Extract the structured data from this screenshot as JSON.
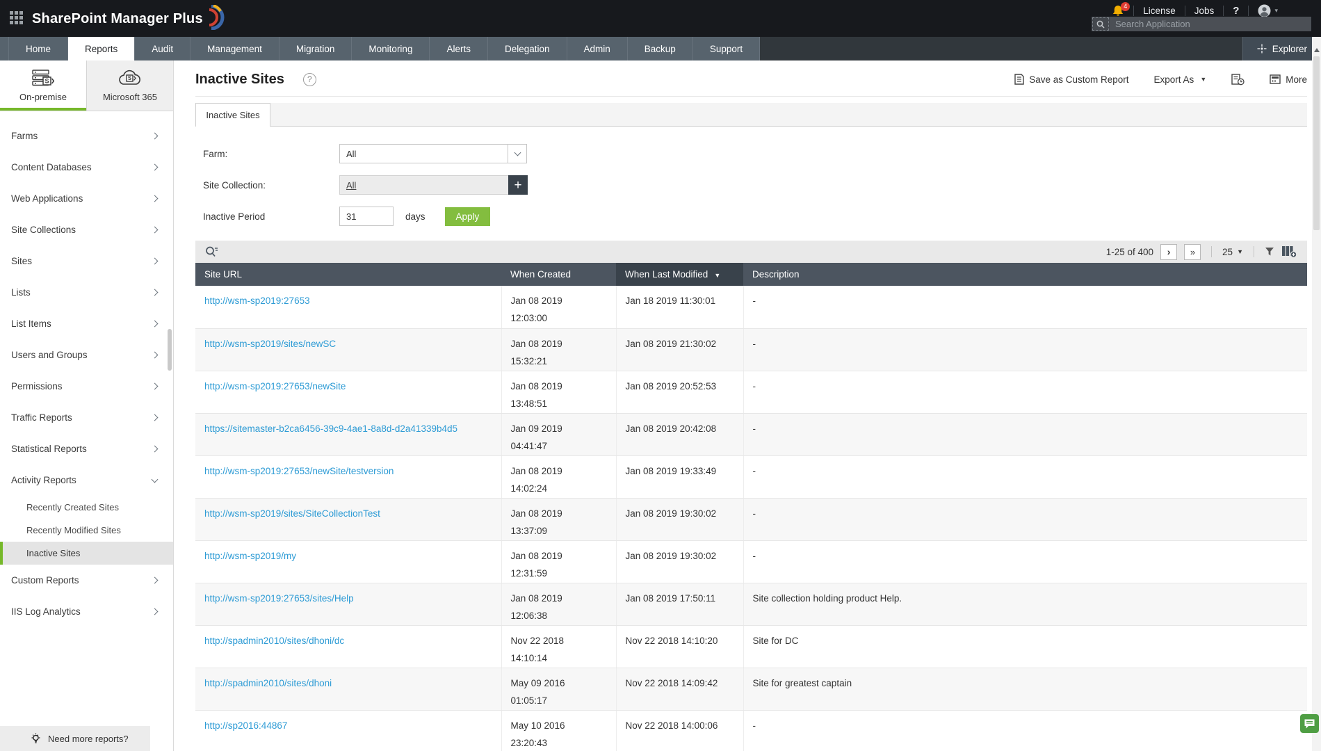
{
  "colors": {
    "accent_green": "#76b82a",
    "apply_green": "#83bd3f",
    "link_blue": "#2d9bd5",
    "table_header_slate": "#4c5560",
    "table_header_sorted": "#39424b",
    "bell_yellow": "#f2ae00",
    "badge_red": "#e03c31",
    "chat_green": "#4f9e44"
  },
  "topbar": {
    "product_name": "SharePoint Manager Plus",
    "notification_count": "4",
    "license_label": "License",
    "jobs_label": "Jobs",
    "help_label": "?",
    "search_placeholder": "Search Application"
  },
  "nav": {
    "tabs": [
      {
        "label": "Home"
      },
      {
        "label": "Reports",
        "active": true
      },
      {
        "label": "Audit"
      },
      {
        "label": "Management"
      },
      {
        "label": "Migration"
      },
      {
        "label": "Monitoring"
      },
      {
        "label": "Alerts"
      },
      {
        "label": "Delegation"
      },
      {
        "label": "Admin"
      },
      {
        "label": "Backup"
      },
      {
        "label": "Support"
      }
    ],
    "explorer_label": "Explorer"
  },
  "sidebar": {
    "tabs": [
      {
        "label": "On-premise",
        "icon": "server-icon",
        "active": true
      },
      {
        "label": "Microsoft 365",
        "icon": "cloud-icon",
        "active": false
      }
    ],
    "items": [
      {
        "label": "Farms"
      },
      {
        "label": "Content Databases"
      },
      {
        "label": "Web Applications"
      },
      {
        "label": "Site Collections"
      },
      {
        "label": "Sites"
      },
      {
        "label": "Lists"
      },
      {
        "label": "List Items"
      },
      {
        "label": "Users and Groups"
      },
      {
        "label": "Permissions"
      },
      {
        "label": "Traffic Reports"
      },
      {
        "label": "Statistical Reports"
      },
      {
        "label": "Activity Reports",
        "expanded": true,
        "children": [
          "Recently Created Sites",
          "Recently Modified Sites",
          "Inactive Sites"
        ],
        "selected_child": "Inactive Sites"
      },
      {
        "label": "Custom Reports"
      },
      {
        "label": "IIS Log Analytics"
      }
    ],
    "footer_label": "Need more reports?"
  },
  "report": {
    "title": "Inactive Sites",
    "help_glyph": "?",
    "actions": {
      "save_label": "Save as Custom Report",
      "export_label": "Export As",
      "more_label": "More"
    },
    "tab_label": "Inactive Sites",
    "filters": {
      "farm_label": "Farm:",
      "farm_value": "All",
      "site_collection_label": "Site Collection:",
      "site_collection_value": "All",
      "period_label": "Inactive Period",
      "period_value": "31",
      "days_label": "days",
      "apply_label": "Apply"
    },
    "pagination": {
      "range": "1-25 of 400",
      "page_size": "25"
    },
    "table": {
      "columns": [
        "Site URL",
        "When Created",
        "When Last Modified",
        "Description"
      ],
      "sort_column": "When Last Modified",
      "sort_direction": "descending",
      "rows": [
        {
          "url": "http://wsm-sp2019:27653",
          "created_date": "Jan 08 2019",
          "created_time": "12:03:00",
          "modified": "Jan 18 2019 11:30:01",
          "description": "-"
        },
        {
          "url": "http://wsm-sp2019/sites/newSC",
          "created_date": "Jan 08 2019",
          "created_time": "15:32:21",
          "modified": "Jan 08 2019 21:30:02",
          "description": "-"
        },
        {
          "url": "http://wsm-sp2019:27653/newSite",
          "created_date": "Jan 08 2019",
          "created_time": "13:48:51",
          "modified": "Jan 08 2019 20:52:53",
          "description": "-"
        },
        {
          "url": "https://sitemaster-b2ca6456-39c9-4ae1-8a8d-d2a41339b4d5",
          "created_date": "Jan 09 2019",
          "created_time": "04:41:47",
          "modified": "Jan 08 2019 20:42:08",
          "description": "-"
        },
        {
          "url": "http://wsm-sp2019:27653/newSite/testversion",
          "created_date": "Jan 08 2019",
          "created_time": "14:02:24",
          "modified": "Jan 08 2019 19:33:49",
          "description": "-"
        },
        {
          "url": "http://wsm-sp2019/sites/SiteCollectionTest",
          "created_date": "Jan 08 2019",
          "created_time": "13:37:09",
          "modified": "Jan 08 2019 19:30:02",
          "description": "-"
        },
        {
          "url": "http://wsm-sp2019/my",
          "created_date": "Jan 08 2019",
          "created_time": "12:31:59",
          "modified": "Jan 08 2019 19:30:02",
          "description": "-"
        },
        {
          "url": "http://wsm-sp2019:27653/sites/Help",
          "created_date": "Jan 08 2019",
          "created_time": "12:06:38",
          "modified": "Jan 08 2019 17:50:11",
          "description": "Site collection holding product Help."
        },
        {
          "url": "http://spadmin2010/sites/dhoni/dc",
          "created_date": "Nov 22 2018",
          "created_time": "14:10:14",
          "modified": "Nov 22 2018 14:10:20",
          "description": "Site for DC"
        },
        {
          "url": "http://spadmin2010/sites/dhoni",
          "created_date": "May 09 2016",
          "created_time": "01:05:17",
          "modified": "Nov 22 2018 14:09:42",
          "description": "Site for greatest captain"
        },
        {
          "url": "http://sp2016:44867",
          "created_date": "May 10 2016",
          "created_time": "23:20:43",
          "modified": "Nov 22 2018 14:00:06",
          "description": "-"
        }
      ]
    }
  }
}
